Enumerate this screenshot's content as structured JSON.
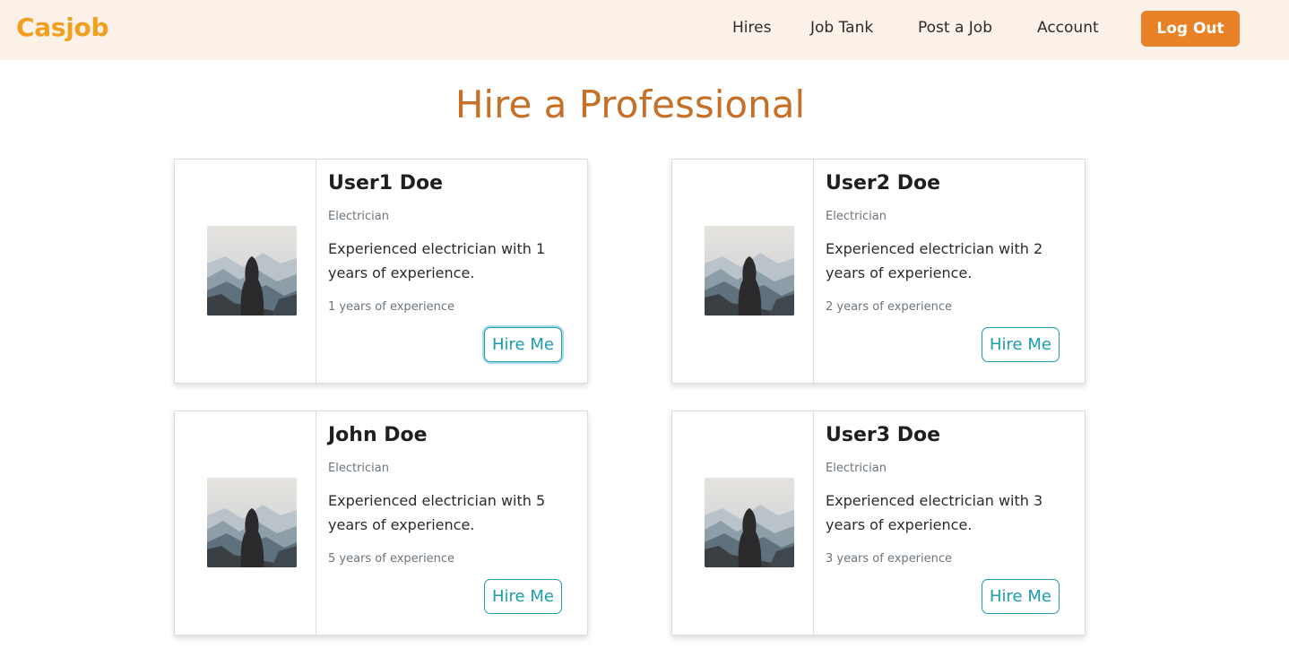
{
  "nav": {
    "brand": "Casjob",
    "links": [
      "Hires",
      "Job Tank",
      "Post a Job",
      "Account"
    ],
    "logout_label": "Log Out"
  },
  "main": {
    "title": "Hire a Professional"
  },
  "professionals": [
    {
      "name": "User1 Doe",
      "profession": "Electrician",
      "bio": "Experienced electrician with 1 years of experience.",
      "experience": "1 years of experience",
      "button_label": "Hire Me"
    },
    {
      "name": "User2 Doe",
      "profession": "Electrician",
      "bio": "Experienced electrician with 2 years of experience.",
      "experience": "2 years of experience",
      "button_label": "Hire Me"
    },
    {
      "name": "John Doe",
      "profession": "Electrician",
      "bio": "Experienced electrician with 5 years of experience.",
      "experience": "5 years of experience",
      "button_label": "Hire Me"
    },
    {
      "name": "User3 Doe",
      "profession": "Electrician",
      "bio": "Experienced electrician with 3 years of experience.",
      "experience": "3 years of experience",
      "button_label": "Hire Me"
    }
  ],
  "colors": {
    "brand": "#f0a01e",
    "navbar_bg": "#fbf1e8",
    "accent": "#e98226",
    "title": "#c66f26",
    "hire_button": "#1b9cb0"
  }
}
